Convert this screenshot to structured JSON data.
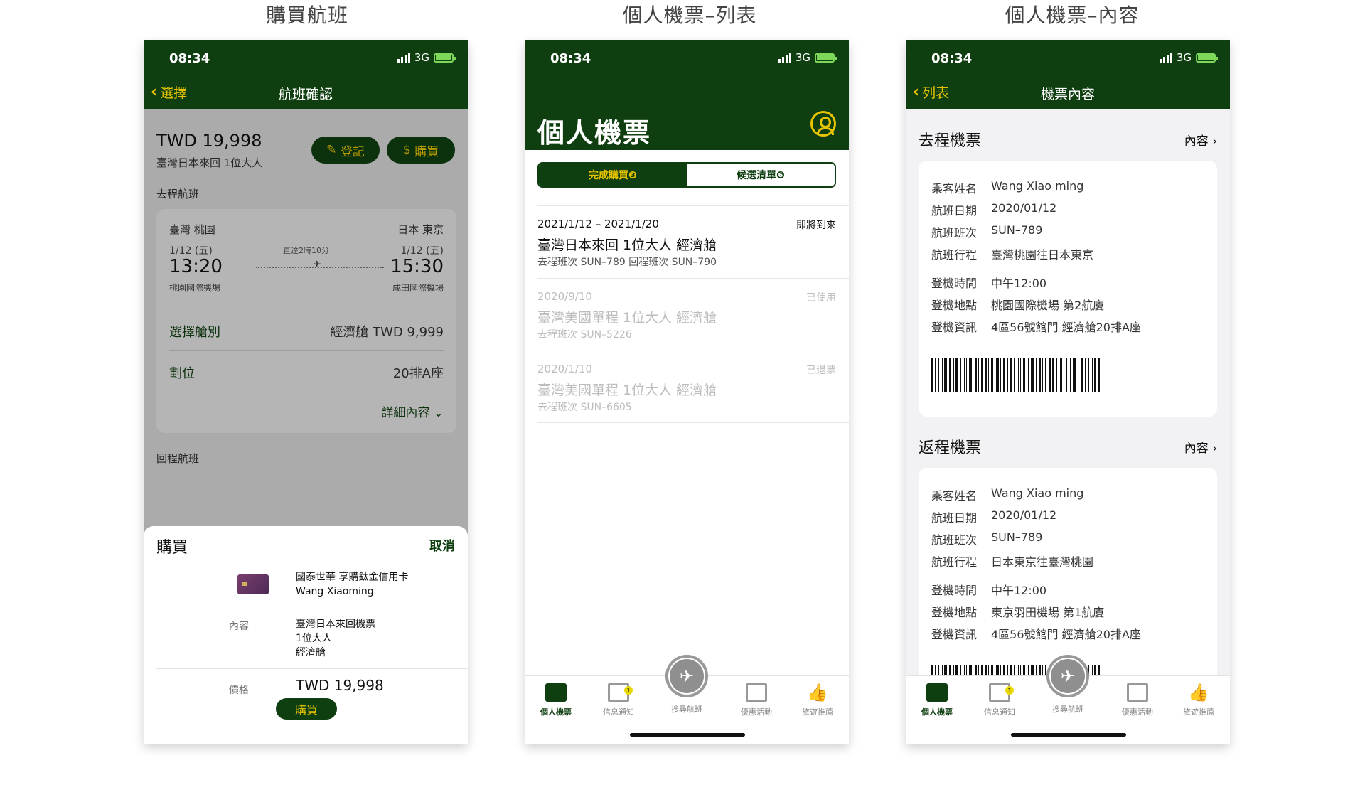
{
  "captions": [
    "購買航班",
    "個人機票–列表",
    "個人機票–內容"
  ],
  "status": {
    "time": "08:34",
    "network": "3G"
  },
  "phone1": {
    "nav": {
      "back": "選擇",
      "title": "航班確認"
    },
    "price": "TWD 19,998",
    "price_sub": "臺灣日本來回 1位大人",
    "checkin_button": "登記",
    "buy_button": "購買",
    "outbound_label": "去程航班",
    "flight": {
      "from": "臺灣 桃園",
      "to": "日本 東京",
      "dep_date": "1/12 (五)",
      "arr_date": "1/12 (五)",
      "dep_time": "13:20",
      "arr_time": "15:30",
      "duration": "直達2時10分",
      "dep_airport": "桃園國際機場",
      "arr_airport": "成田國際機場"
    },
    "cabin": {
      "label": "選擇艙別",
      "value": "經濟艙 TWD 9,999"
    },
    "seat": {
      "label": "劃位",
      "value": "20排A座"
    },
    "detail": "詳細內容",
    "return_label": "回程航班",
    "sheet": {
      "title": "購買",
      "cancel": "取消",
      "card_name": "國泰世華 享購鈦金信用卡",
      "card_holder": "Wang Xiaoming",
      "content_label": "內容",
      "content_1": "臺灣日本來回機票",
      "content_2": "1位大人",
      "content_3": "經濟艙",
      "price_label": "價格",
      "price_value": "TWD 19,998",
      "buy": "購買"
    }
  },
  "phone2": {
    "title": "個人機票",
    "seg_done": "完成購買❸",
    "seg_wait": "候選清單❻",
    "tickets": [
      {
        "date": "2021/1/12 – 2021/1/20",
        "status": "即將到來",
        "name": "臺灣日本來回 1位大人 經濟艙",
        "flights": "去程班次 SUN–789    回程班次 SUN–790"
      },
      {
        "date": "2020/9/10",
        "status": "已使用",
        "name": "臺灣美國單程 1位大人 經濟艙",
        "flights": "去程班次 SUN–5226"
      },
      {
        "date": "2020/1/10",
        "status": "已退票",
        "name": "臺灣美國單程 1位大人 經濟艙",
        "flights": "去程班次 SUN–6605"
      }
    ]
  },
  "tabs": [
    "個人機票",
    "信息通知",
    "搜尋航班",
    "優惠活動",
    "旅遊推薦"
  ],
  "notify_badge": "1",
  "phone3": {
    "nav": {
      "back": "列表",
      "title": "機票內容"
    },
    "sections": [
      {
        "title": "去程機票",
        "more": "內容",
        "rows": [
          [
            "乘客姓名",
            "Wang Xiao ming"
          ],
          [
            "航班日期",
            "2020/01/12"
          ],
          [
            "航班班次",
            "SUN–789"
          ],
          [
            "航班行程",
            "臺灣桃園往日本東京"
          ]
        ],
        "rows2": [
          [
            "登機時間",
            "中午12:00"
          ],
          [
            "登機地點",
            "桃園國際機場 第2航廈"
          ],
          [
            "登機資訊",
            "4區56號館門 經濟艙20排A座"
          ]
        ]
      },
      {
        "title": "返程機票",
        "more": "內容",
        "rows": [
          [
            "乘客姓名",
            "Wang Xiao ming"
          ],
          [
            "航班日期",
            "2020/01/12"
          ],
          [
            "航班班次",
            "SUN–789"
          ],
          [
            "航班行程",
            "日本東京往臺灣桃園"
          ]
        ],
        "rows2": [
          [
            "登機時間",
            "中午12:00"
          ],
          [
            "登機地點",
            "東京羽田機場 第1航廈"
          ],
          [
            "登機資訊",
            "4區56號館門 經濟艙20排A座"
          ]
        ]
      }
    ]
  },
  "colors": {
    "brand_green": "#0f3f11",
    "accent_yellow": "#e8c400"
  }
}
